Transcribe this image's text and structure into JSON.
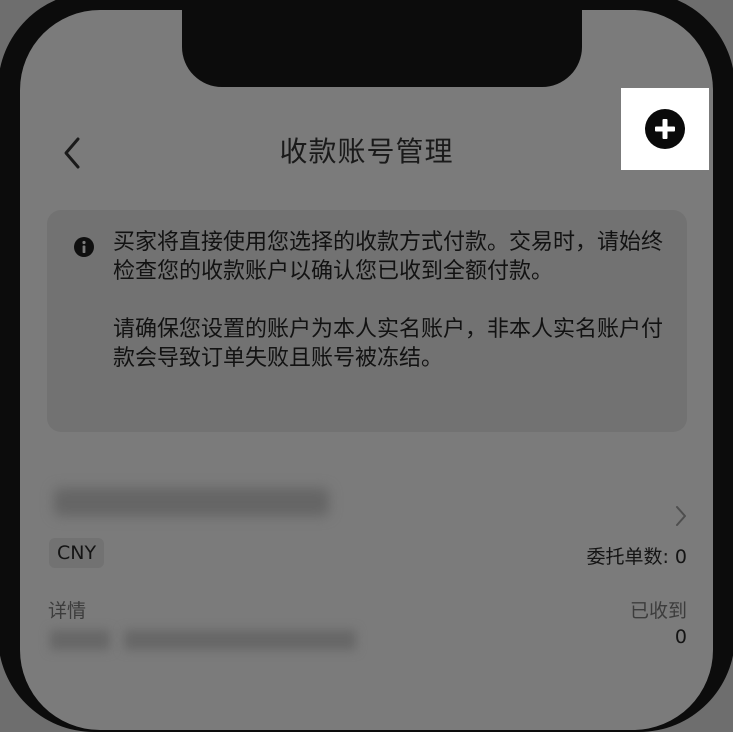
{
  "header": {
    "title": "收款账号管理",
    "back_icon": "chevron-left-icon",
    "add_icon": "plus-circle-icon"
  },
  "notice": {
    "icon": "info-icon",
    "paragraph_1": "买家将直接使用您选择的收款方式付款。交易时，请始终检查您的收款账户以确认您已收到全额付款。",
    "paragraph_2": "请确保您设置的账户为本人实名账户，非本人实名账户付款会导致订单失败且账号被冻结。"
  },
  "account": {
    "currency": "CNY",
    "order_count_label": "委托单数: 0",
    "detail_label": "详情",
    "received_label": "已收到",
    "received_value": "0"
  },
  "colors": {
    "highlight": "#ffffff",
    "overlay_background": "#7b7b7b",
    "phone_frame": "#0c0c0c"
  }
}
